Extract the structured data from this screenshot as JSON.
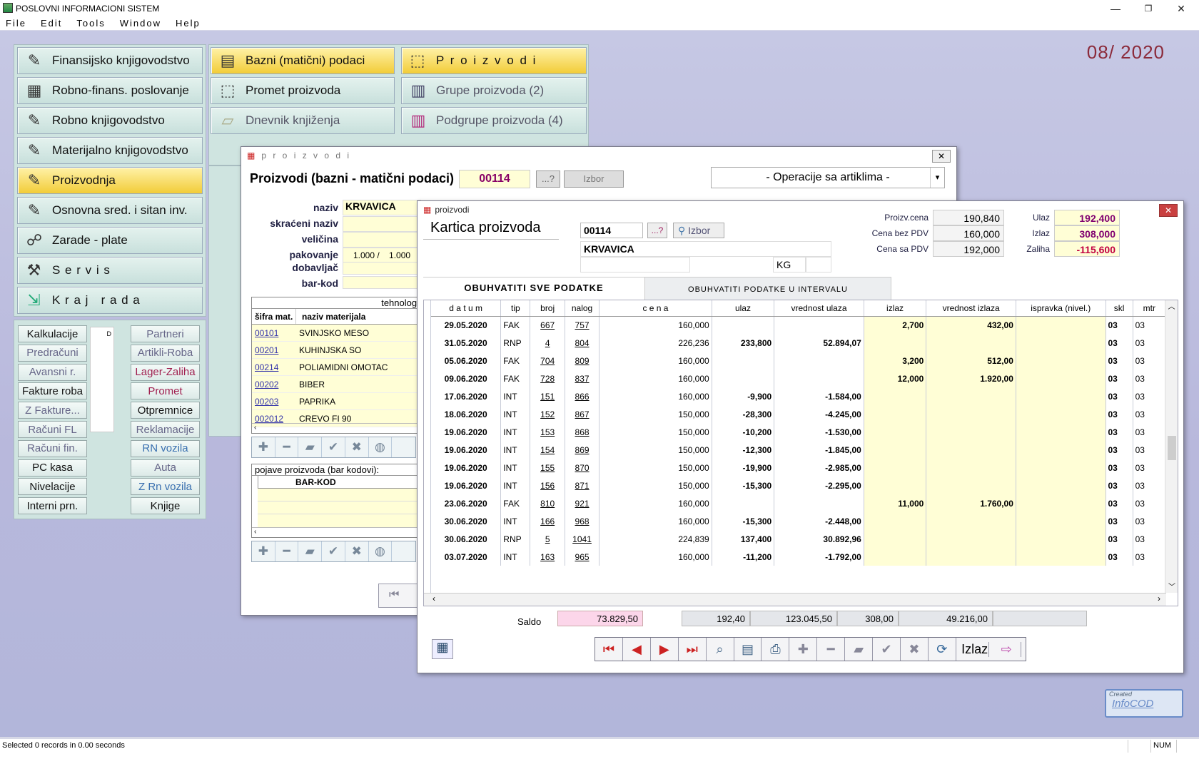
{
  "app": {
    "title": "POSLOVNI INFORMACIONI SISTEM",
    "period": "08/ 2020"
  },
  "menu": [
    "File",
    "Edit",
    "Tools",
    "Window",
    "Help"
  ],
  "main_menu": [
    "Finansijsko knjigovodstvo",
    "Robno-finans. poslovanje",
    "Robno knjigovodstvo",
    "Materijalno knjigovodstvo",
    "Proizvodnja",
    "Osnovna sred. i sitan inv.",
    "Zarade - plate",
    "S e r v i s",
    "K r a j   r a d a"
  ],
  "menu2": [
    "Bazni (matični) podaci",
    "Promet proizvoda",
    "Dnevnik knjiženja"
  ],
  "menu3": [
    "P r o i z v o d i",
    "Grupe proizvoda (2)",
    "Podgrupe proizvoda (4)"
  ],
  "small_left": [
    "Kalkulacije",
    "Predračuni",
    "Avansni r.",
    "Fakture roba",
    "Z Fakture...",
    "Računi FL",
    "Računi fin.",
    "PC kasa",
    "Nivelacije",
    "Interni prn."
  ],
  "small_right": [
    "Partneri",
    "Artikli-Roba",
    "Lager-Zaliha",
    "Promet",
    "Otpremnice",
    "Reklamacije",
    "RN vozila",
    "Auta",
    "Z Rn vozila",
    "Knjige"
  ],
  "win1": {
    "title": "p r o i z v o d i",
    "heading": "Proizvodi (bazni - matični podaci)",
    "code": "00114",
    "query": "...?",
    "izbor": "Izbor",
    "ops": "- Operacije sa artiklima -",
    "labels": [
      "naziv",
      "skraćeni naziv",
      "veličina",
      "pakovanje",
      "dobavljač",
      "bar-kod"
    ],
    "naziv": "KRVAVICA",
    "pakovanje": "1.000 /    1.000",
    "tech": "tehnologi",
    "mat_headers": [
      "šifra mat.",
      "naziv materijala"
    ],
    "materials": [
      [
        "00101",
        "SVINJSKO MESO"
      ],
      [
        "00201",
        "KUHINJSKA SO"
      ],
      [
        "00214",
        "POLIAMIDNI OMOTAC"
      ],
      [
        "00202",
        "BIBER"
      ],
      [
        "00203",
        "PAPRIKA"
      ],
      [
        "002012",
        "CREVO FI 90"
      ]
    ],
    "barcodes_title": "pojave proizvoda (bar kodovi):",
    "barcode_header": "BAR-KOD"
  },
  "win2": {
    "title": "proizvodi",
    "heading": "Kartica proizvoda",
    "code": "00114",
    "query": "...?",
    "izbor": "Izbor",
    "naziv": "KRVAVICA",
    "unit": "KG",
    "prices": [
      [
        "Proizv.cena",
        "190,840"
      ],
      [
        "Cena bez PDV",
        "160,000"
      ],
      [
        "Cena sa PDV",
        "192,000"
      ]
    ],
    "stock": [
      [
        "Ulaz",
        "192,400"
      ],
      [
        "Izlaz",
        "308,000"
      ],
      [
        "Zaliha",
        "-115,600"
      ]
    ],
    "tab_all": "OBUHVATITI  SVE  PODATKE",
    "tab_interval": "OBUHVATITI  PODATKE  U  INTERVALU",
    "headers": [
      "d a t u m",
      "tip",
      "broj",
      "nalog",
      "c e n a",
      "ulaz",
      "vrednost ulaza",
      "izlaz",
      "vrednost izlaza",
      "ispravka (nivel.)",
      "skl",
      "mtr"
    ],
    "rows": [
      [
        "29.05.2020",
        "FAK",
        "667",
        "757",
        "160,000",
        "",
        "",
        "2,700",
        "432,00",
        "",
        "03",
        "03"
      ],
      [
        "31.05.2020",
        "RNP",
        "4",
        "804",
        "226,236",
        "233,800",
        "52.894,07",
        "",
        "",
        "",
        "03",
        "03"
      ],
      [
        "05.06.2020",
        "FAK",
        "704",
        "809",
        "160,000",
        "",
        "",
        "3,200",
        "512,00",
        "",
        "03",
        "03"
      ],
      [
        "09.06.2020",
        "FAK",
        "728",
        "837",
        "160,000",
        "",
        "",
        "12,000",
        "1.920,00",
        "",
        "03",
        "03"
      ],
      [
        "17.06.2020",
        "INT",
        "151",
        "866",
        "160,000",
        "-9,900",
        "-1.584,00",
        "",
        "",
        "",
        "03",
        "03"
      ],
      [
        "18.06.2020",
        "INT",
        "152",
        "867",
        "150,000",
        "-28,300",
        "-4.245,00",
        "",
        "",
        "",
        "03",
        "03"
      ],
      [
        "19.06.2020",
        "INT",
        "153",
        "868",
        "150,000",
        "-10,200",
        "-1.530,00",
        "",
        "",
        "",
        "03",
        "03"
      ],
      [
        "19.06.2020",
        "INT",
        "154",
        "869",
        "150,000",
        "-12,300",
        "-1.845,00",
        "",
        "",
        "",
        "03",
        "03"
      ],
      [
        "19.06.2020",
        "INT",
        "155",
        "870",
        "150,000",
        "-19,900",
        "-2.985,00",
        "",
        "",
        "",
        "03",
        "03"
      ],
      [
        "19.06.2020",
        "INT",
        "156",
        "871",
        "150,000",
        "-15,300",
        "-2.295,00",
        "",
        "",
        "",
        "03",
        "03"
      ],
      [
        "23.06.2020",
        "FAK",
        "810",
        "921",
        "160,000",
        "",
        "",
        "11,000",
        "1.760,00",
        "",
        "03",
        "03"
      ],
      [
        "30.06.2020",
        "INT",
        "166",
        "968",
        "160,000",
        "-15,300",
        "-2.448,00",
        "",
        "",
        "",
        "03",
        "03"
      ],
      [
        "30.06.2020",
        "RNP",
        "5",
        "1041",
        "224,839",
        "137,400",
        "30.892,96",
        "",
        "",
        "",
        "03",
        "03"
      ],
      [
        "03.07.2020",
        "INT",
        "163",
        "965",
        "160,000",
        "-11,200",
        "-1.792,00",
        "",
        "",
        "",
        "03",
        "03"
      ]
    ],
    "saldo_label": "Saldo",
    "saldo": "73.829,50",
    "sum_ulaz": "192,40",
    "sum_vu": "123.045,50",
    "sum_izlaz": "308,00",
    "sum_vi": "49.216,00",
    "izlaz_btn": "Izlaz"
  },
  "status": {
    "text": "Selected 0 records in 0.00 seconds",
    "num": "NUM"
  },
  "logo": {
    "line1": "Created",
    "line2": "InfoCOD"
  }
}
